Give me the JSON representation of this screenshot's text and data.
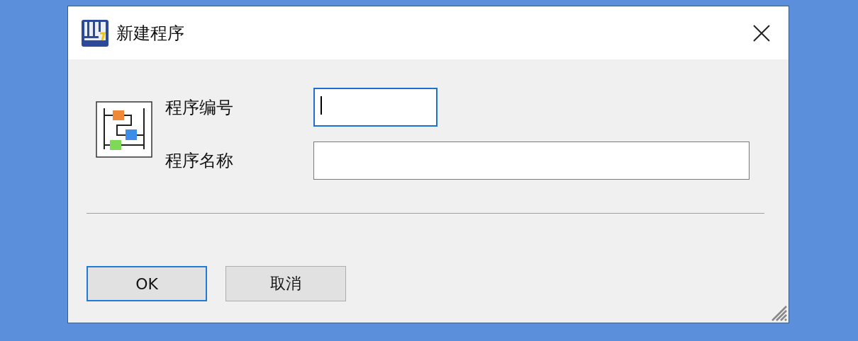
{
  "window": {
    "title": "新建程序"
  },
  "fields": [
    {
      "label": "程序编号",
      "focused": true
    },
    {
      "label": "程序名称",
      "focused": false
    }
  ],
  "buttons": [
    {
      "label": "OK",
      "default": true
    },
    {
      "label": "取消",
      "default": false
    }
  ]
}
